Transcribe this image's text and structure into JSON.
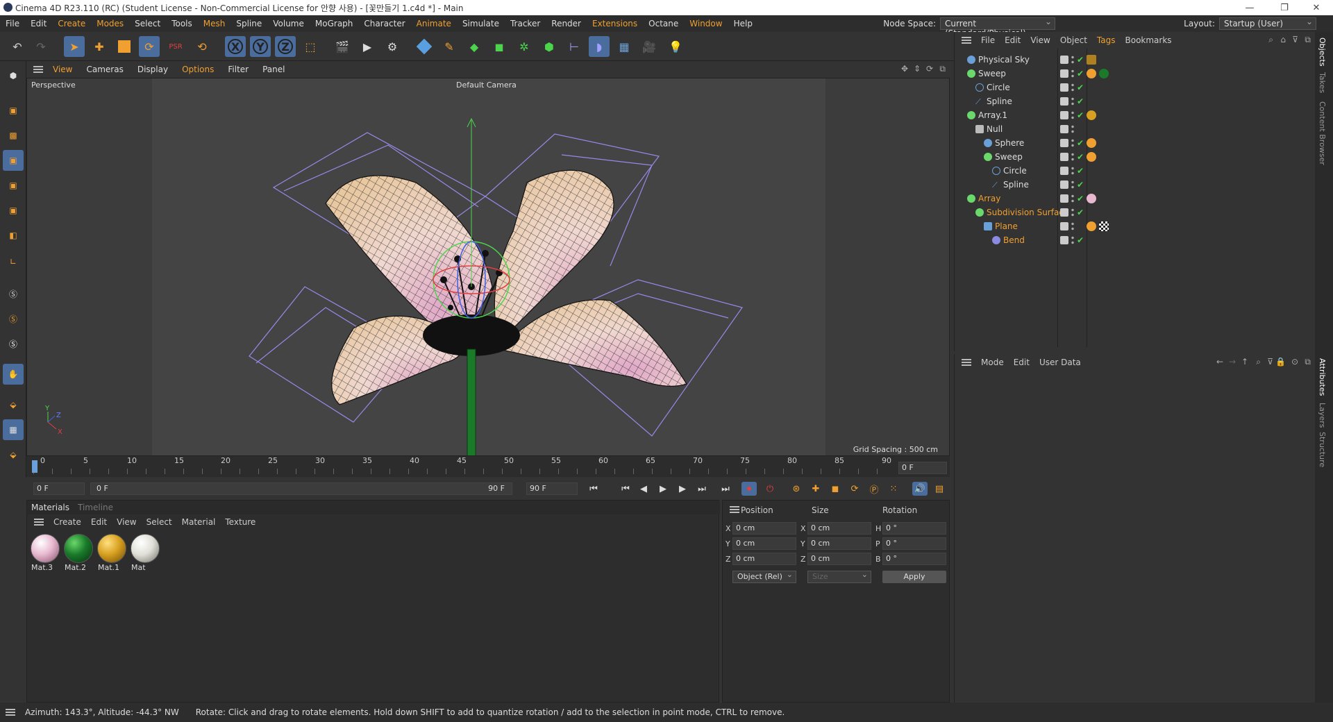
{
  "titlebar": {
    "title": "Cinema 4D R23.110 (RC) (Student License - Non-Commercial License for 안향 사용) - [꽃만들기 1.c4d *] - Main",
    "minimize": "—",
    "restore": "❐",
    "close": "✕"
  },
  "menubar": {
    "items": [
      "File",
      "Edit",
      "Create",
      "Modes",
      "Select",
      "Tools",
      "Mesh",
      "Spline",
      "Volume",
      "MoGraph",
      "Character",
      "Animate",
      "Simulate",
      "Tracker",
      "Render",
      "Extensions",
      "Octane",
      "Window",
      "Help"
    ],
    "node_space_label": "Node Space:",
    "node_space_value": "Current (Standard/Physical)",
    "layout_label": "Layout:",
    "layout_value": "Startup (User)"
  },
  "viewport": {
    "menu": [
      "View",
      "Cameras",
      "Display",
      "Options",
      "Filter",
      "Panel"
    ],
    "view_name": "Perspective",
    "camera": "Default Camera",
    "grid_spacing": "Grid Spacing : 500 cm",
    "axis_y": "Y",
    "axis_z": "Z",
    "axis_x": "X"
  },
  "timeline": {
    "ticks": [
      "0",
      "5",
      "10",
      "15",
      "20",
      "25",
      "30",
      "35",
      "40",
      "45",
      "50",
      "55",
      "60",
      "65",
      "70",
      "75",
      "80",
      "85",
      "90"
    ],
    "current_frame": "0 F"
  },
  "transport": {
    "start": "0 F",
    "range_start": "0 F",
    "range_end": "90 F",
    "end": "90 F"
  },
  "materials": {
    "tabs": [
      "Materials",
      "Timeline"
    ],
    "menu": [
      "Create",
      "Edit",
      "View",
      "Select",
      "Material",
      "Texture"
    ],
    "items": [
      {
        "name": "Mat.3",
        "color": "#e8b8d0"
      },
      {
        "name": "Mat.2",
        "color": "#1a7a2a"
      },
      {
        "name": "Mat.1",
        "color": "#d8a020"
      },
      {
        "name": "Mat",
        "color": "#e0e0d8"
      }
    ]
  },
  "coords": {
    "headers": [
      "Position",
      "Size",
      "Rotation"
    ],
    "rows": [
      {
        "a": "X",
        "pos": "0 cm",
        "b": "X",
        "size": "0 cm",
        "c": "H",
        "rot": "0 °"
      },
      {
        "a": "Y",
        "pos": "0 cm",
        "b": "Y",
        "size": "0 cm",
        "c": "P",
        "rot": "0 °"
      },
      {
        "a": "Z",
        "pos": "0 cm",
        "b": "Z",
        "size": "0 cm",
        "c": "B",
        "rot": "0 °"
      }
    ],
    "mode": "Object (Rel)",
    "size_mode": "Size",
    "apply": "Apply"
  },
  "objects": {
    "menu": [
      "File",
      "Edit",
      "View",
      "Object",
      "Tags",
      "Bookmarks"
    ],
    "tree": [
      {
        "name": "Physical Sky",
        "indent": 0,
        "style": "",
        "icon": "#6aa0d8"
      },
      {
        "name": "Sweep",
        "indent": 0,
        "style": "",
        "icon": "#6ad86a"
      },
      {
        "name": "Circle",
        "indent": 1,
        "style": "",
        "icon": "#6aa0d8"
      },
      {
        "name": "Spline",
        "indent": 1,
        "style": "",
        "icon": "#6aa0d8"
      },
      {
        "name": "Array.1",
        "indent": 0,
        "style": "",
        "icon": "#6ad86a"
      },
      {
        "name": "Null",
        "indent": 1,
        "style": "",
        "icon": "#bbb"
      },
      {
        "name": "Sphere",
        "indent": 2,
        "style": "",
        "icon": "#6aa0d8"
      },
      {
        "name": "Sweep",
        "indent": 2,
        "style": "",
        "icon": "#6ad86a"
      },
      {
        "name": "Circle",
        "indent": 3,
        "style": "",
        "icon": "#6aa0d8"
      },
      {
        "name": "Spline",
        "indent": 3,
        "style": "",
        "icon": "#6aa0d8"
      },
      {
        "name": "Array",
        "indent": 0,
        "style": "org",
        "icon": "#6ad86a"
      },
      {
        "name": "Subdivision Surface",
        "indent": 1,
        "style": "org",
        "icon": "#6ad86a"
      },
      {
        "name": "Plane",
        "indent": 2,
        "style": "org",
        "icon": "#6aa0d8"
      },
      {
        "name": "Bend",
        "indent": 3,
        "style": "org",
        "icon": "#8a8ae0"
      }
    ]
  },
  "attributes": {
    "menu": [
      "Mode",
      "Edit",
      "User Data"
    ]
  },
  "sidetabs": {
    "top": [
      "Objects",
      "Takes",
      "Content Browser"
    ],
    "bottom": [
      "Attributes",
      "Layers",
      "Structure"
    ]
  },
  "status": {
    "azimuth": "Azimuth: 143.3°, Altitude: -44.3°  NW",
    "hint": "Rotate: Click and drag to rotate elements. Hold down SHIFT to add to quantize rotation / add to the selection in point mode, CTRL to remove."
  }
}
